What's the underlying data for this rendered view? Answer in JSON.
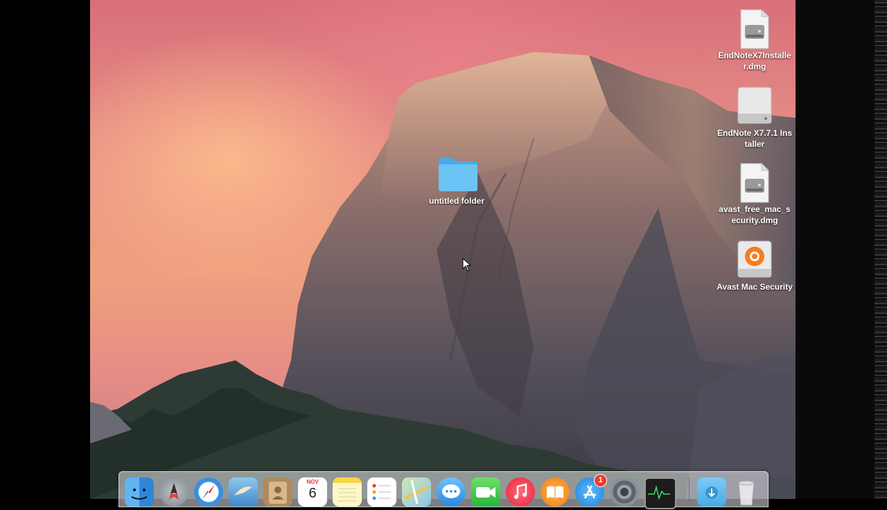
{
  "desktop": {
    "icons": [
      {
        "label": "EndNoteX7Installer.dmg",
        "icon": "disk-image-icon"
      },
      {
        "label": "EndNote X7.7.1 Installer",
        "icon": "mounted-volume-icon"
      },
      {
        "label": "avast_free_mac_security.dmg",
        "icon": "disk-image-icon"
      },
      {
        "label": "Avast Mac Security",
        "icon": "avast-volume-icon"
      },
      {
        "label": "untitled folder",
        "icon": "folder-icon"
      }
    ]
  },
  "dock": {
    "calendar_month": "NOV",
    "calendar_day": "6",
    "app_store_badge": "1",
    "apps": [
      "finder",
      "launchpad",
      "safari",
      "mail",
      "contacts",
      "calendar",
      "notes",
      "reminders",
      "maps",
      "messages",
      "facetime",
      "itunes",
      "ibooks",
      "app-store",
      "system-preferences",
      "activity-monitor",
      "downloads",
      "trash"
    ]
  },
  "colors": {
    "folder": "#6cc4f4",
    "badge": "#f03a2f",
    "label_text": "#ffffff"
  }
}
